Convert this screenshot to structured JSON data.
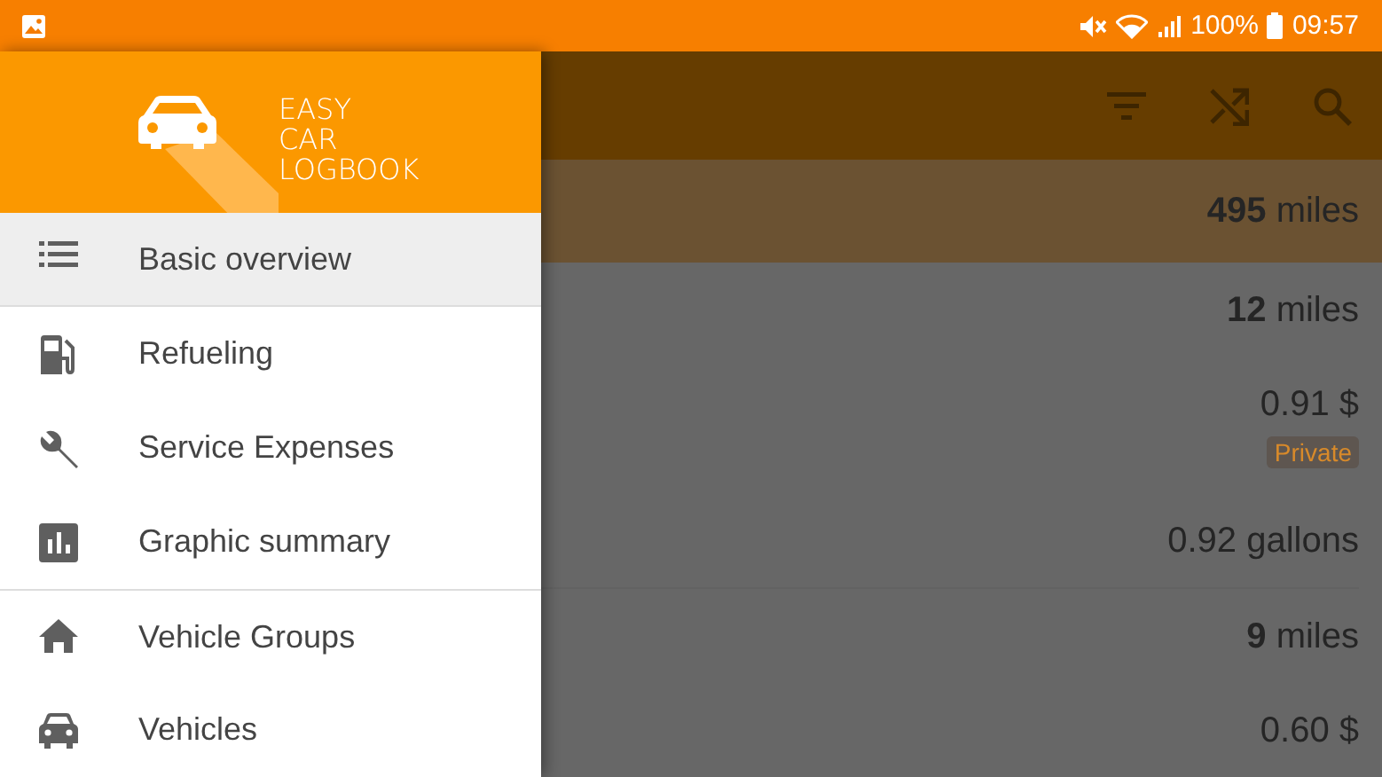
{
  "status_bar": {
    "battery": "100%",
    "time": "09:57"
  },
  "drawer": {
    "app_name": "EASY\nCAR\nLOGBOOK",
    "items": [
      {
        "label": "Basic overview",
        "kind": "list",
        "selected": true,
        "divider_before": false
      },
      {
        "label": "Refueling",
        "kind": "fuel",
        "selected": false,
        "divider_before": false
      },
      {
        "label": "Service Expenses",
        "kind": "wrench",
        "selected": false,
        "divider_before": false
      },
      {
        "label": "Graphic summary",
        "kind": "chart",
        "selected": false,
        "divider_before": false
      },
      {
        "label": "Vehicle Groups",
        "kind": "home",
        "selected": false,
        "divider_before": true
      },
      {
        "label": "Vehicles",
        "kind": "car",
        "selected": false,
        "divider_before": false
      }
    ]
  },
  "summary": {
    "value": "**495** miles"
  },
  "entries": [
    {
      "value": "**12** miles",
      "divider_before": false
    },
    {
      "value": "0.91 $",
      "tag": "Private",
      "divider_before": false
    },
    {
      "value": "0.92 gallons",
      "divider_before": false
    },
    {
      "value": "**9** miles",
      "divider_before": true
    },
    {
      "value": "0.60 $",
      "divider_before": false
    }
  ]
}
